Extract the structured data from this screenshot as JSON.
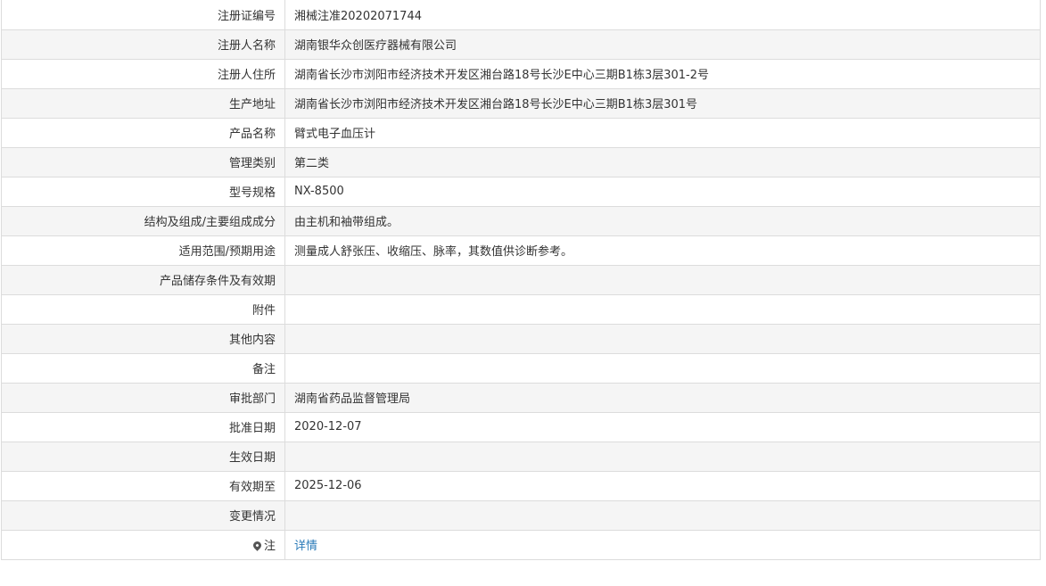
{
  "rows": [
    {
      "label": "注册证编号",
      "value": "湘械注准20202071744"
    },
    {
      "label": "注册人名称",
      "value": "湖南银华众创医疗器械有限公司"
    },
    {
      "label": "注册人住所",
      "value": "湖南省长沙市浏阳市经济技术开发区湘台路18号长沙E中心三期B1栋3层301-2号"
    },
    {
      "label": "生产地址",
      "value": "湖南省长沙市浏阳市经济技术开发区湘台路18号长沙E中心三期B1栋3层301号"
    },
    {
      "label": "产品名称",
      "value": "臂式电子血压计"
    },
    {
      "label": "管理类别",
      "value": "第二类"
    },
    {
      "label": "型号规格",
      "value": "NX-8500"
    },
    {
      "label": "结构及组成/主要组成成分",
      "value": "由主机和袖带组成。"
    },
    {
      "label": "适用范围/预期用途",
      "value": "测量成人舒张压、收缩压、脉率，其数值供诊断参考。"
    },
    {
      "label": "产品储存条件及有效期",
      "value": ""
    },
    {
      "label": "附件",
      "value": ""
    },
    {
      "label": "其他内容",
      "value": ""
    },
    {
      "label": "备注",
      "value": ""
    },
    {
      "label": "审批部门",
      "value": "湖南省药品监督管理局"
    },
    {
      "label": "批准日期",
      "value": "2020-12-07"
    },
    {
      "label": "生效日期",
      "value": ""
    },
    {
      "label": "有效期至",
      "value": "2025-12-06"
    },
    {
      "label": "变更情况",
      "value": ""
    }
  ],
  "note_row": {
    "label": "注",
    "icon": "pin-icon",
    "link_text": "详情"
  }
}
